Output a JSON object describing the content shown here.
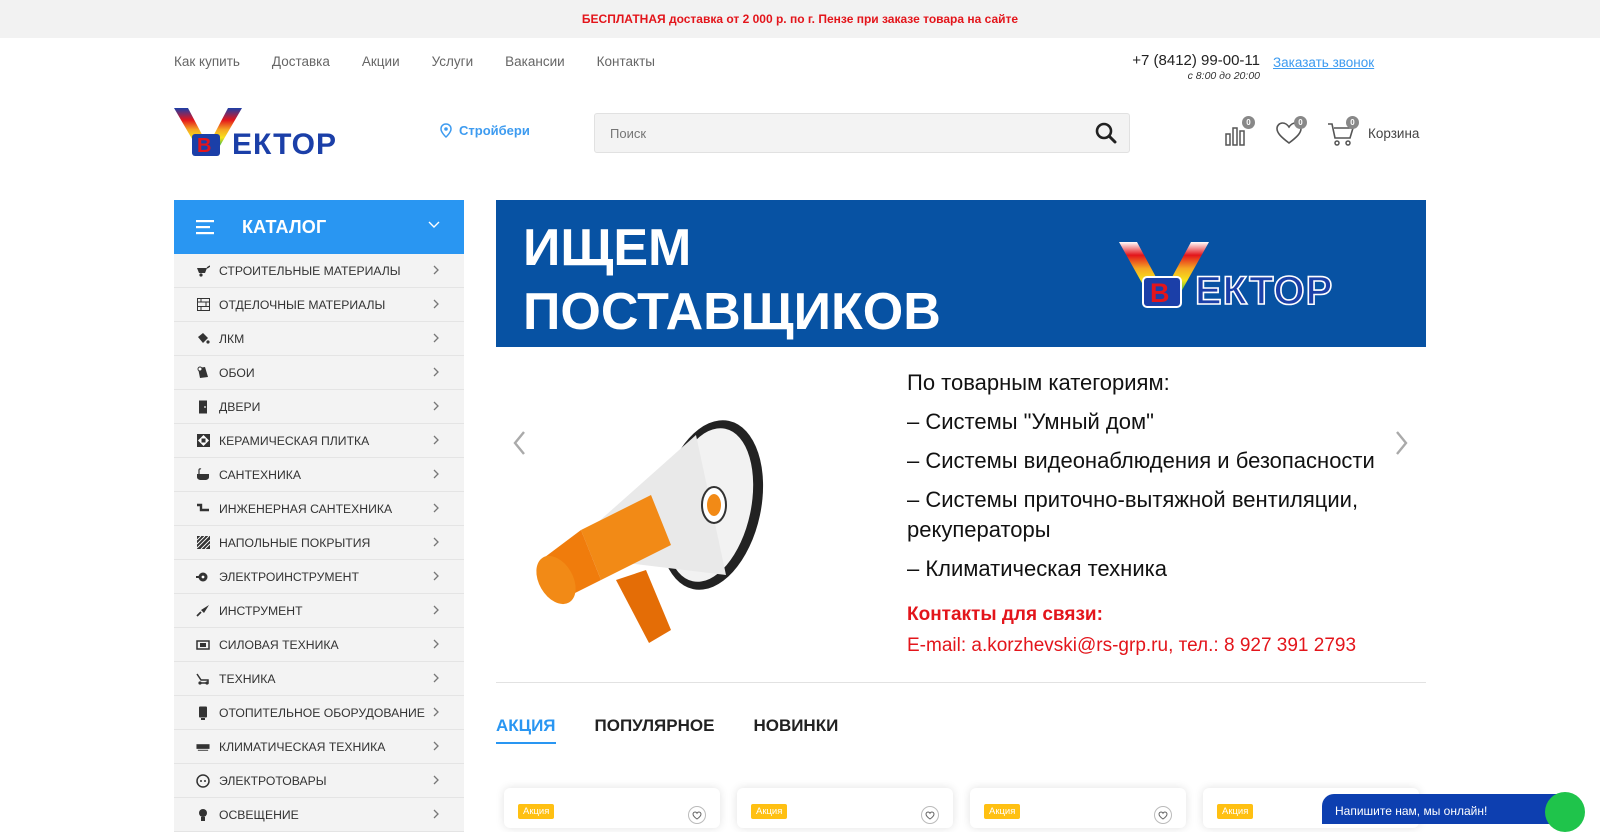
{
  "topbar": {
    "promo": "БЕСПЛАТНАЯ доставка от 2 000 р. по г. Пензе при заказе товара на сайте"
  },
  "nav": {
    "links": [
      "Как купить",
      "Доставка",
      "Акции",
      "Услуги",
      "Вакансии",
      "Контакты"
    ],
    "phone": "+7 (8412) 99-00-11",
    "hours": "с 8:00 до 20:00",
    "callback": "Заказать звонок"
  },
  "header": {
    "location": "Стройбери",
    "search_placeholder": "Поиск",
    "compare_count": "0",
    "favorites_count": "0",
    "cart_count": "0",
    "cart_label": "Корзина"
  },
  "catalog": {
    "title": "КАТАЛОГ",
    "items": [
      "СТРОИТЕЛЬНЫЕ МАТЕРИАЛЫ",
      "ОТДЕЛОЧНЫЕ МАТЕРИАЛЫ",
      "ЛКМ",
      "ОБОИ",
      "ДВЕРИ",
      "КЕРАМИЧЕСКАЯ ПЛИТКА",
      "САНТЕХНИКА",
      "ИНЖЕНЕРНАЯ САНТЕХНИКА",
      "НАПОЛЬНЫЕ ПОКРЫТИЯ",
      "ЭЛЕКТРОИНСТРУМЕНТ",
      "ИНСТРУМЕНТ",
      "СИЛОВАЯ ТЕХНИКА",
      "ТЕХНИКА",
      "ОТОПИТЕЛЬНОЕ ОБОРУДОВАНИЕ",
      "КЛИМАТИЧЕСКАЯ ТЕХНИКА",
      "ЭЛЕКТРОТОВАРЫ",
      "ОСВЕЩЕНИЕ"
    ]
  },
  "banner": {
    "title_line1": "ИЩЕМ",
    "title_line2": "ПОСТАВЩИКОВ",
    "lines": [
      "По товарным категориям:",
      "– Системы \"Умный дом\"",
      "– Системы видеонаблюдения и безопасности",
      "– Системы приточно-вытяжной вентиляции, рекуператоры",
      "– Климатическая техника"
    ],
    "contacts_heading": "Контакты для связи:",
    "contacts_line": "E-mail: a.korzhevski@rs-grp.ru, тел.: 8 927 391 2793"
  },
  "tabs": [
    "АКЦИЯ",
    "ПОПУЛЯРНОЕ",
    "НОВИНКИ"
  ],
  "cards": {
    "badge": "Акция"
  },
  "chat": {
    "label": "Напишите нам, мы онлайн!"
  },
  "colors": {
    "accent": "#2996f2",
    "promo": "#e3151b",
    "banner": "#0752a3",
    "sale": "#ffc012"
  }
}
